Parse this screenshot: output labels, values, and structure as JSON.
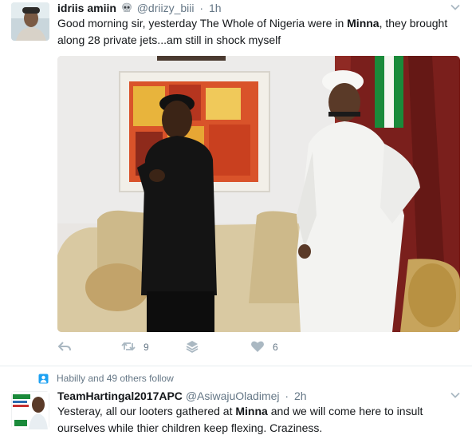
{
  "tweets": [
    {
      "name": "idriis amiin",
      "emoji_icon": "skull-icon",
      "handle": "@driizy_biii",
      "separator": "·",
      "time": "1h",
      "text_parts": [
        {
          "t": "Good morning sir, yesterday The Whole of Nigeria were in ",
          "b": false
        },
        {
          "t": "Minna",
          "b": true
        },
        {
          "t": ", they brought along 28 private jets...am still in shock myself",
          "b": false
        }
      ],
      "actions": {
        "reply_icon": "reply-icon",
        "retweet_icon": "retweet-icon",
        "retweet_count": "9",
        "moments_icon": "layers-icon",
        "like_icon": "heart-icon",
        "like_count": "6"
      }
    },
    {
      "social_context": "Habilly and 49 others follow",
      "social_icon": "person-follow-icon",
      "name": "TeamHartingal2017APC",
      "handle": "@AsiwajuOladimej",
      "separator": "·",
      "time": "2h",
      "text_parts": [
        {
          "t": "Yesteray, all our looters gathered at ",
          "b": false
        },
        {
          "t": "Minna",
          "b": true
        },
        {
          "t": " and we will come here to insult ourselves while thier children keep flexing. Craziness.",
          "b": false
        }
      ]
    }
  ],
  "colors": {
    "text": "#14171a",
    "secondary": "#657786",
    "icon": "#aab8c2",
    "social_icon": "#1da1f2",
    "divider": "#e6ecf0"
  }
}
